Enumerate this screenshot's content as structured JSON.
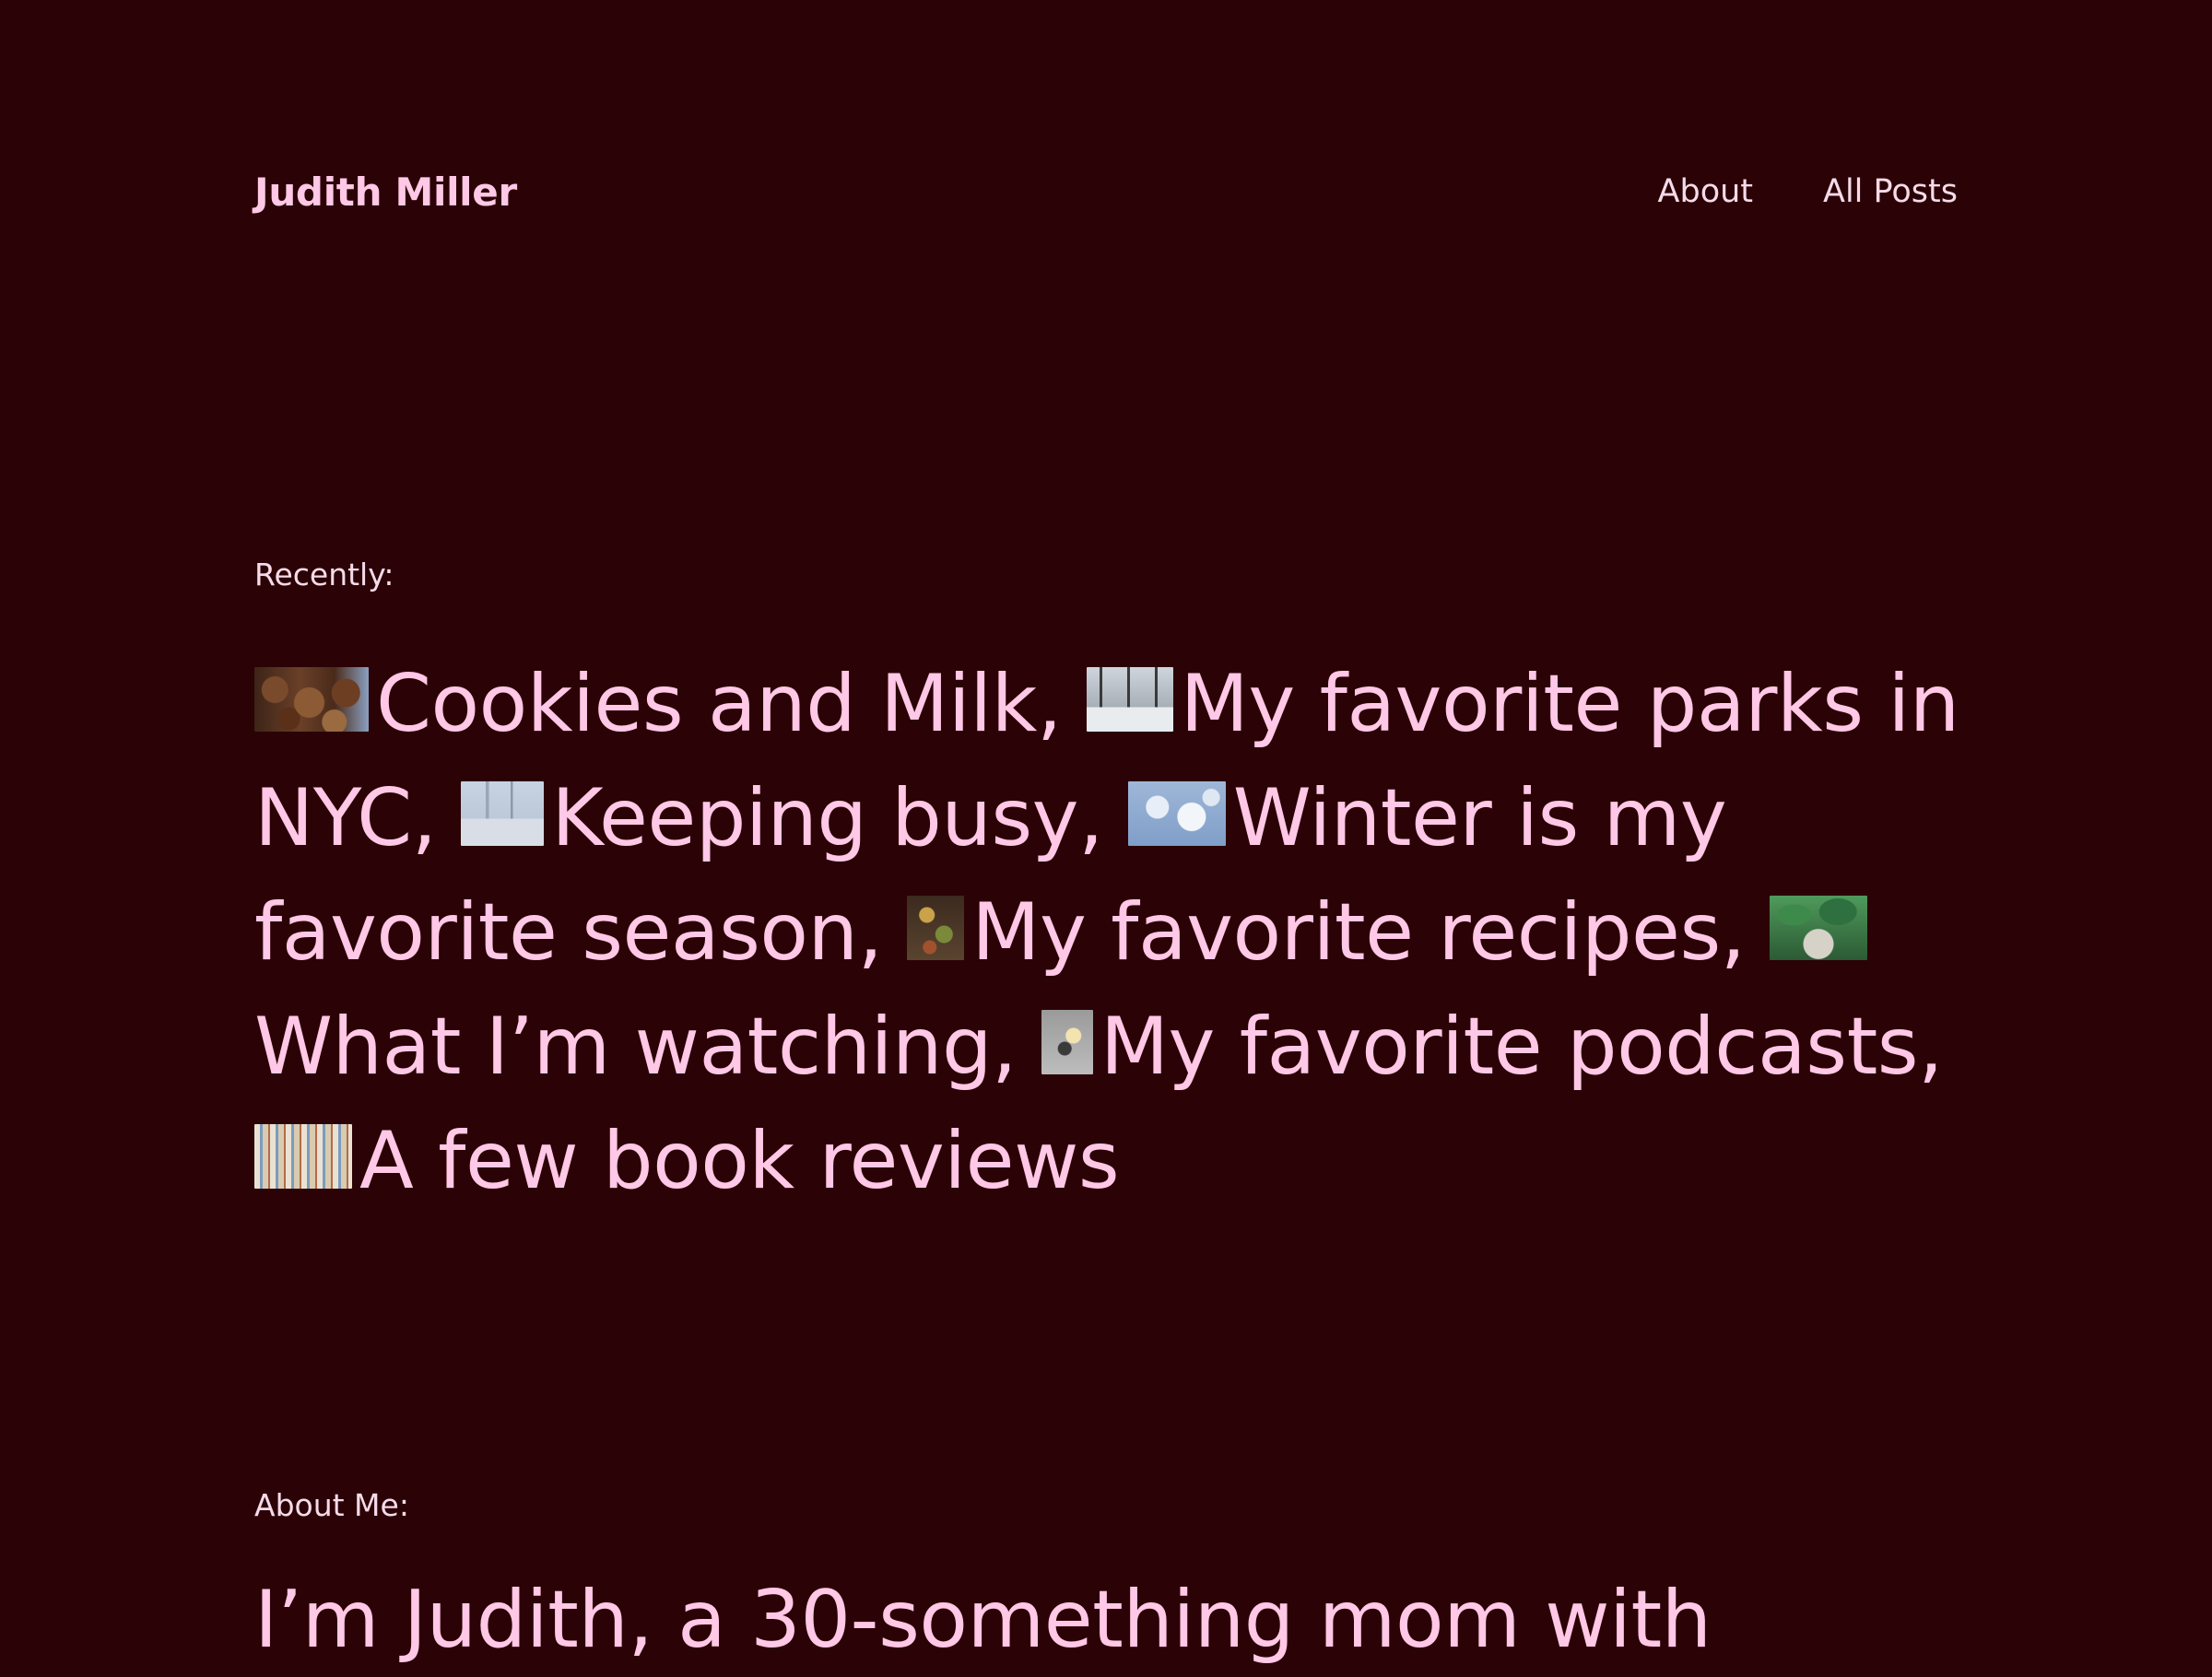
{
  "site": {
    "title": "Judith Miller"
  },
  "nav": {
    "items": [
      {
        "label": "About"
      },
      {
        "label": "All Posts"
      }
    ]
  },
  "recent": {
    "label": "Recently:",
    "posts": [
      {
        "title": "Cookies and Milk",
        "separator": ",",
        "icon": "cookies-thumbnail"
      },
      {
        "title": "My favorite parks in NYC",
        "separator": ",",
        "icon": "snowy-park-thumbnail"
      },
      {
        "title": "Keeping busy",
        "separator": ",",
        "icon": "winter-city-thumbnail"
      },
      {
        "title": "Winter is my favorite season",
        "separator": ",",
        "icon": "snow-thumbnail"
      },
      {
        "title": "My favorite recipes",
        "separator": ",",
        "icon": "food-thumbnail"
      },
      {
        "title": "What I’m watching",
        "separator": ",",
        "icon": "plants-thumbnail"
      },
      {
        "title": "My favorite podcasts",
        "separator": ",",
        "icon": "coffee-thumbnail"
      },
      {
        "title": "A few book reviews",
        "separator": "",
        "icon": "books-thumbnail"
      }
    ]
  },
  "about": {
    "label": "About Me:",
    "text": "I’m Judith, a 30-something mom with"
  },
  "colors": {
    "background": "#2b0205",
    "accent": "#ffc8e6",
    "muted": "#f5dbe9"
  }
}
